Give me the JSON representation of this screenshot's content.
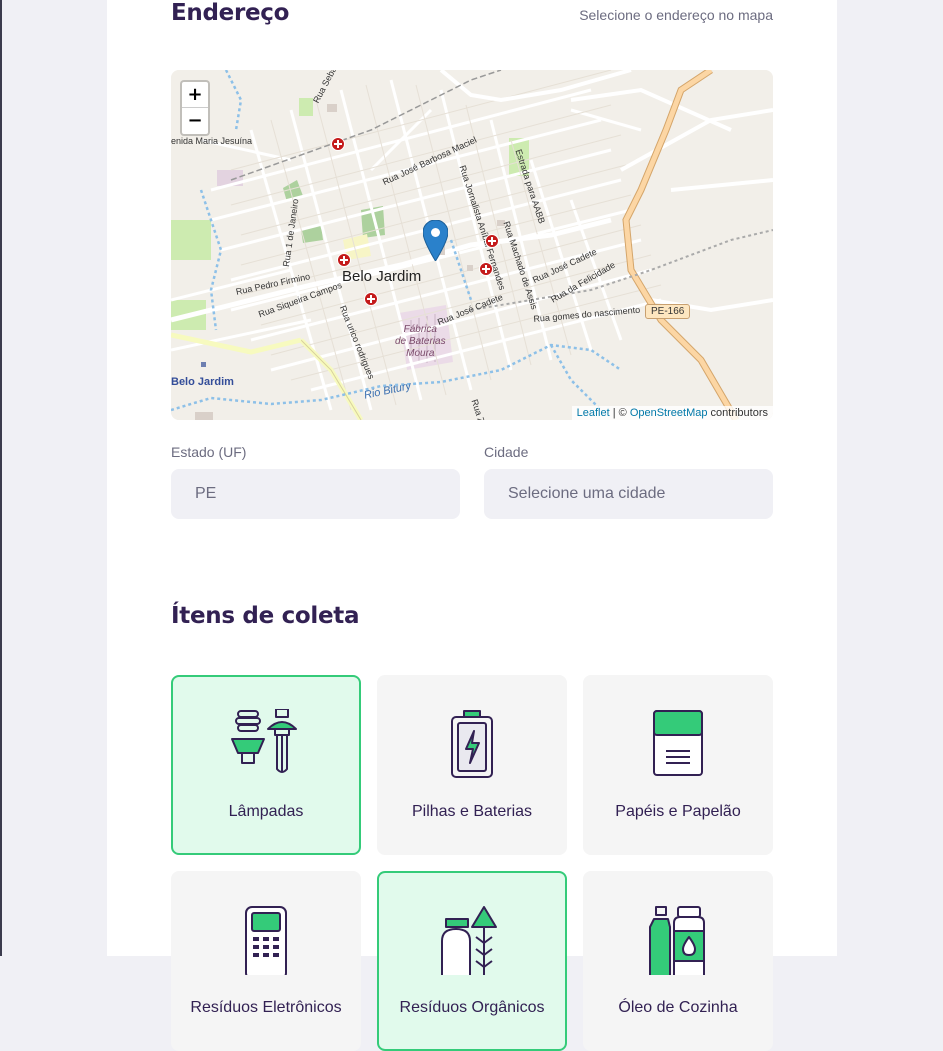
{
  "address": {
    "title": "Endereço",
    "hint": "Selecione o endereço no mapa"
  },
  "map": {
    "zoom_in": "+",
    "zoom_out": "−",
    "attribution": {
      "leaflet": "Leaflet",
      "separator": " | © ",
      "osm": "OpenStreetMap",
      "suffix": " contributors"
    },
    "labels": {
      "town": "Belo Jardim",
      "town_alt": "Belo Jardim",
      "river": "Rio Bitury",
      "factory_line1": "Fábrica",
      "factory_line2": "de Baterias",
      "factory_line3": "Moura",
      "road_shield": "PE-166",
      "s1": "Rua Sebastião Rodrigu",
      "s2": "enida Maria Jesuína",
      "s3": "Rua José Barbosa Maciel",
      "s4": "Rua Jornalista Aníbal Fernandes",
      "s5": "Estrada para AABB",
      "s6": "Rua Machado de Assis",
      "s7": "Rua José Cadete",
      "s8": "Rua da Felicidade",
      "s9": "Rua gomes do nascimento",
      "s10": "Rua José Cadete",
      "s11": "Rua Pedro Firmino",
      "s12": "Rua Siqueira Campos",
      "s13": "Rua 1 de Janeiro",
      "s14": "Rua urico rodrigues",
      "s15": "Rua Ze"
    }
  },
  "fields": {
    "state_label": "Estado (UF)",
    "state_value": "PE",
    "city_label": "Cidade",
    "city_value": "Selecione uma cidade"
  },
  "items": {
    "title": "Ítens de coleta",
    "list": [
      {
        "label": "Lâmpadas",
        "icon": "lamps-icon",
        "selected": true
      },
      {
        "label": "Pilhas e Baterias",
        "icon": "battery-icon",
        "selected": false
      },
      {
        "label": "Papéis e Papelão",
        "icon": "paper-icon",
        "selected": false
      },
      {
        "label": "Resíduos Eletrônicos",
        "icon": "electronics-icon",
        "selected": false
      },
      {
        "label": "Resíduos Orgânicos",
        "icon": "organic-icon",
        "selected": true
      },
      {
        "label": "Óleo de Cozinha",
        "icon": "oil-icon",
        "selected": false
      }
    ]
  },
  "colors": {
    "primary": "#34cb79",
    "title": "#322153",
    "text": "#6c6c80",
    "input_bg": "#f0f0f5",
    "selected_bg": "#e1faec"
  }
}
